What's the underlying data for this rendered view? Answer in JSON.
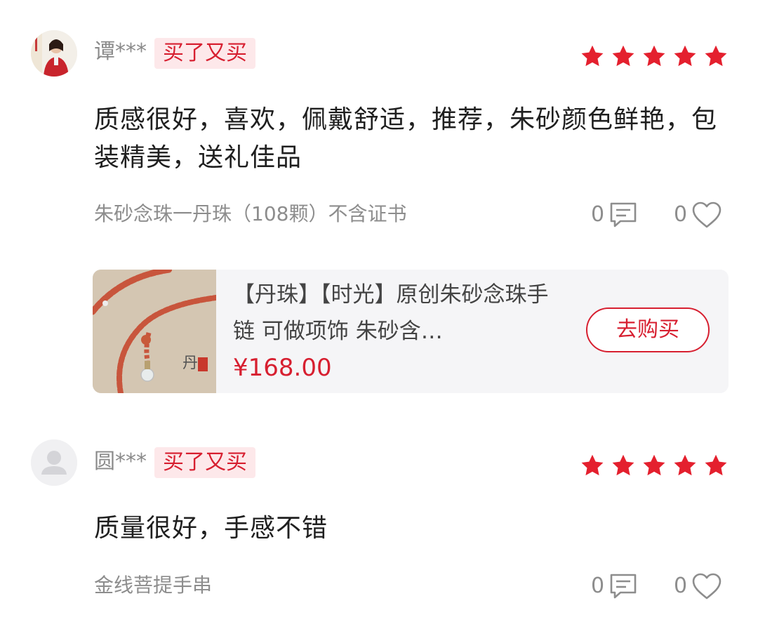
{
  "reviews": [
    {
      "username": "谭***",
      "badge": "买了又买",
      "rating": 5,
      "text": "质感很好，喜欢，佩戴舒适，推荐，朱砂颜色鲜艳，包装精美，送礼佳品",
      "product_line": "朱砂念珠一丹珠（108颗）不含证书",
      "comment_count": "0",
      "like_count": "0",
      "product_card": {
        "title": "【丹珠】【时光】原创朱砂念珠手链 可做项饰 朱砂含…",
        "price": "¥168.00",
        "buy_label": "去购买"
      }
    },
    {
      "username": "圆***",
      "badge": "买了又买",
      "rating": 5,
      "text": "质量很好，手感不错",
      "product_line": "金线菩提手串",
      "comment_count": "0",
      "like_count": "0"
    }
  ],
  "colors": {
    "accent": "#d71f30",
    "badge_bg": "#fde8ea",
    "star": "#e4202e",
    "muted_text": "#8d8d8d",
    "card_bg": "#f5f5f7"
  },
  "icons": {
    "star": "star-icon",
    "comment": "comment-icon",
    "like": "heart-icon",
    "default_avatar": "user-icon"
  }
}
